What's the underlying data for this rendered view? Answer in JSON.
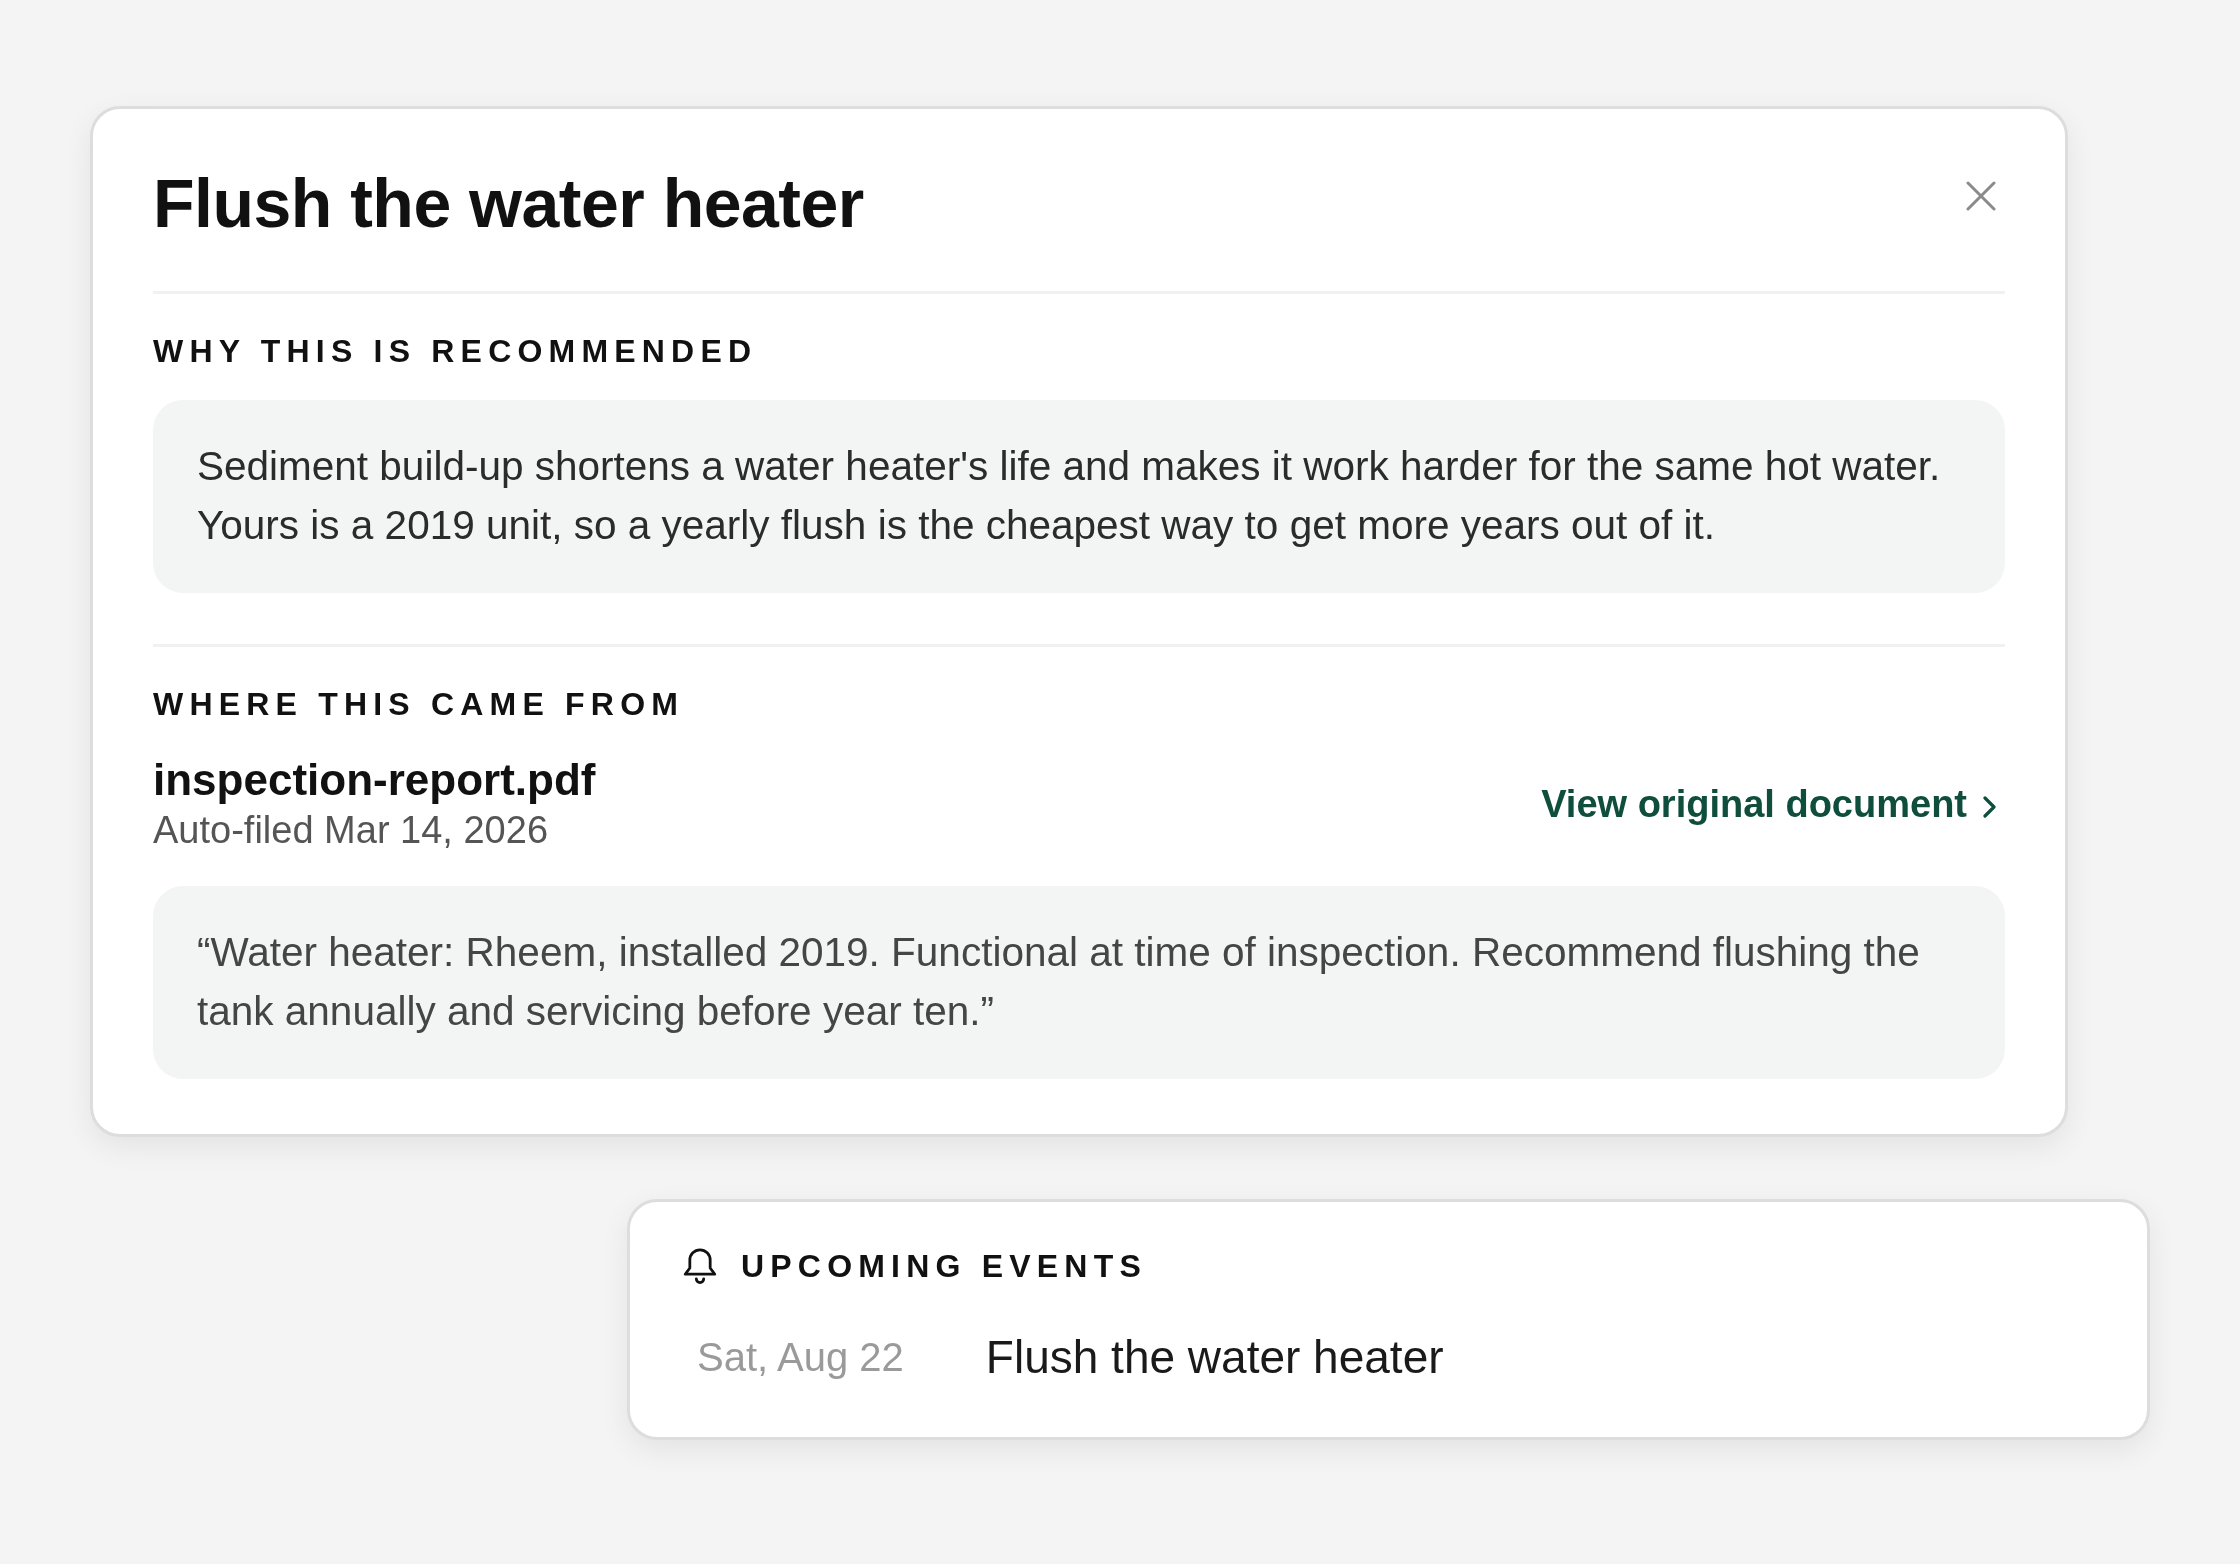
{
  "detail_panel": {
    "title": "Flush the water heater",
    "sections": [
      {
        "kind": "reason",
        "heading": "WHY THIS IS RECOMMENDED",
        "body": "Sediment build-up shortens a water heater's life and makes it work harder for the same hot water. Yours is a 2019 unit, so a yearly flush is the cheapest way to get more years out of it."
      },
      {
        "kind": "source",
        "heading": "WHERE THIS CAME FROM",
        "file_name": "inspection-report.pdf",
        "filed": "Auto-filed Mar 14, 2026",
        "link": "View original document",
        "quote": "“Water heater: Rheem, installed 2019. Functional at time of inspection. Recommend flushing the tank annually and servicing before year ten.”"
      }
    ]
  },
  "upcoming_events": {
    "heading": "UPCOMING EVENTS",
    "events": [
      {
        "date": "Sat, Aug 22",
        "title": "Flush the water heater"
      }
    ]
  }
}
